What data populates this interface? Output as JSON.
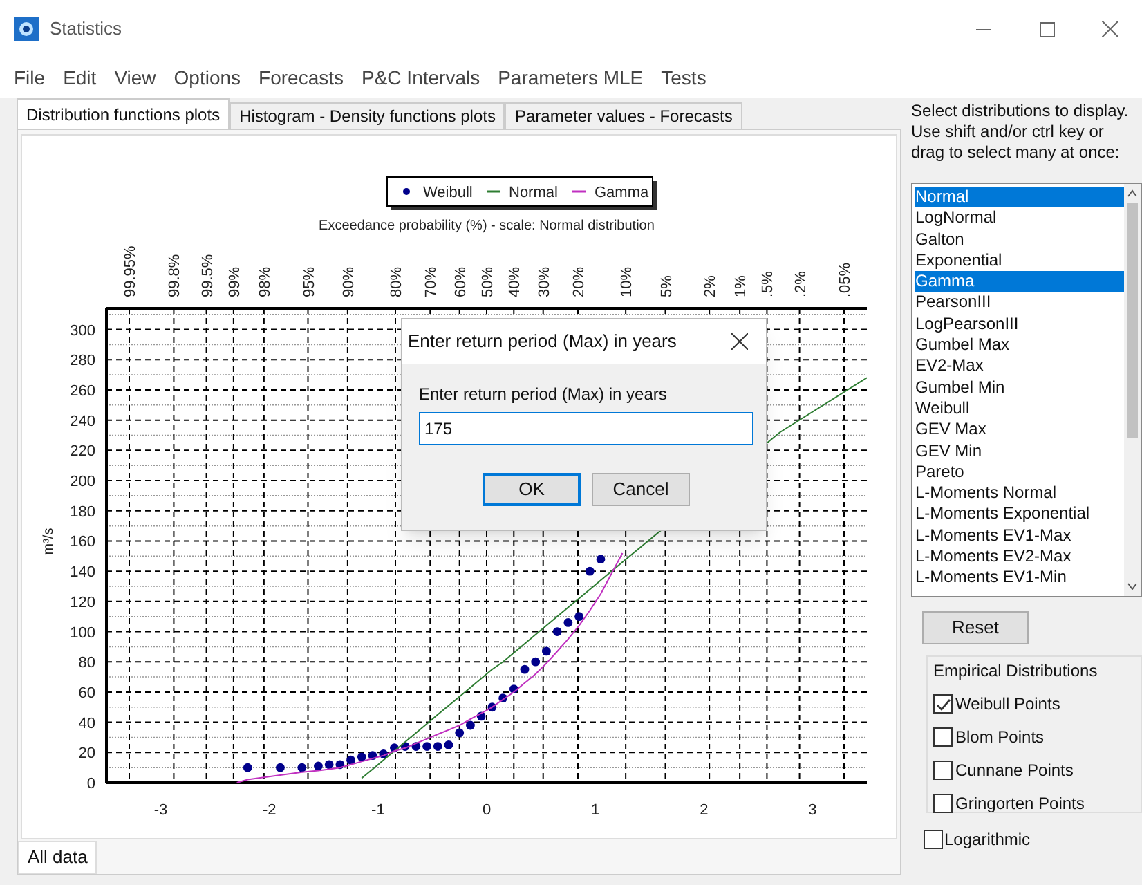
{
  "window": {
    "title": "Statistics"
  },
  "menu": [
    "File",
    "Edit",
    "View",
    "Options",
    "Forecasts",
    "P&C Intervals",
    "Parameters MLE",
    "Tests"
  ],
  "tabs": [
    {
      "label": "Distribution functions plots",
      "selected": true
    },
    {
      "label": "Histogram - Density functions plots",
      "selected": false
    },
    {
      "label": "Parameter values - Forecasts",
      "selected": false
    }
  ],
  "chart": {
    "top_axis": {
      "title": "Exceedance probability (%) - scale: Normal distribution",
      "ticks": [
        "99.95%",
        "99.8%",
        "99.5%",
        "99%",
        "98%",
        "95%",
        "90%",
        "80%",
        "70%",
        "60%",
        "50%",
        "40%",
        "30%",
        "20%",
        "10%",
        "5%",
        "2%",
        "1%",
        ".5%",
        ".2%",
        ".05%"
      ]
    },
    "chart_data": {
      "type": "line",
      "ylabel": "m³/s",
      "legend": "top",
      "grid": true,
      "x": [
        -2.3,
        -2.2,
        -1.9,
        -1.7,
        -1.55,
        -1.45,
        -1.35,
        -1.25,
        -1.15,
        -1.05,
        -0.95,
        -0.85,
        -0.75,
        -0.65,
        -0.55,
        -0.45,
        -0.35,
        -0.25,
        -0.15,
        -0.05,
        0.05,
        0.15,
        0.25,
        0.35,
        0.45,
        0.55,
        0.65,
        0.75,
        0.85,
        0.95,
        1.05,
        1.25,
        2.7,
        3.5
      ],
      "series": [
        {
          "name": "Weibull",
          "type": "scatter",
          "color": "#00008b",
          "values": [
            null,
            10,
            10,
            10,
            11,
            12,
            12,
            15,
            17,
            18,
            19,
            23,
            24,
            24,
            24,
            24,
            25,
            33,
            38,
            44,
            50,
            56,
            62,
            75,
            80,
            87,
            100,
            106,
            110,
            140,
            148,
            null,
            null,
            null
          ]
        },
        {
          "name": "Normal",
          "type": "line",
          "color": "#2e7d32",
          "values": [
            null,
            null,
            null,
            null,
            null,
            null,
            null,
            null,
            3,
            9,
            15,
            21,
            27,
            33,
            39,
            45,
            51,
            57,
            63,
            69,
            75,
            80,
            86,
            92,
            98,
            104,
            110,
            116,
            122,
            128,
            134,
            146,
            232,
            268
          ]
        },
        {
          "name": "Gamma",
          "type": "line",
          "color": "#c030c0",
          "values": [
            0,
            2,
            5,
            7,
            8,
            9,
            10,
            12,
            14,
            16,
            18,
            21,
            23,
            26,
            29,
            32,
            35,
            38,
            42,
            46,
            50,
            55,
            60,
            66,
            72,
            79,
            87,
            95,
            104,
            114,
            125,
            152,
            null,
            null
          ]
        }
      ],
      "xlim": [
        -3.5,
        3.5
      ],
      "ylim": [
        0,
        314
      ],
      "xticks": [
        -3,
        -2,
        -1,
        0,
        1,
        2,
        3
      ],
      "yticks": [
        0,
        20,
        40,
        60,
        80,
        100,
        120,
        140,
        160,
        180,
        200,
        220,
        240,
        260,
        280,
        300
      ]
    }
  },
  "bottom_tabs": [
    {
      "label": "All data",
      "selected": true
    }
  ],
  "dialog": {
    "title": "Enter return period (Max) in years",
    "prompt": "Enter return period (Max) in years",
    "value": "175",
    "buttons": [
      {
        "label": "OK",
        "kind": "primary"
      },
      {
        "label": "Cancel",
        "kind": "secondary"
      }
    ]
  },
  "sidebar": {
    "instructions": [
      "Select distributions to display.",
      "Use shift and/or ctrl key or",
      "drag to select many at once:"
    ],
    "distributions": [
      {
        "label": "Normal",
        "selected": true
      },
      {
        "label": "LogNormal",
        "selected": false
      },
      {
        "label": "Galton",
        "selected": false
      },
      {
        "label": "Exponential",
        "selected": false
      },
      {
        "label": "Gamma",
        "selected": true
      },
      {
        "label": "PearsonIII",
        "selected": false
      },
      {
        "label": "LogPearsonIII",
        "selected": false
      },
      {
        "label": "Gumbel Max",
        "selected": false
      },
      {
        "label": "EV2-Max",
        "selected": false
      },
      {
        "label": "Gumbel Min",
        "selected": false
      },
      {
        "label": "Weibull",
        "selected": false
      },
      {
        "label": "GEV Max",
        "selected": false
      },
      {
        "label": "GEV Min",
        "selected": false
      },
      {
        "label": "Pareto",
        "selected": false
      },
      {
        "label": "L-Moments Normal",
        "selected": false
      },
      {
        "label": "L-Moments Exponential",
        "selected": false
      },
      {
        "label": "L-Moments EV1-Max",
        "selected": false
      },
      {
        "label": "L-Moments EV2-Max",
        "selected": false
      },
      {
        "label": "L-Moments EV1-Min",
        "selected": false
      }
    ],
    "reset_button": "Reset",
    "group": {
      "title": "Empirical Distributions",
      "options": [
        {
          "label": "Weibull Points",
          "checked": true
        },
        {
          "label": "Blom Points",
          "checked": false
        },
        {
          "label": "Cunnane Points",
          "checked": false
        },
        {
          "label": "Gringorten Points",
          "checked": false
        }
      ]
    },
    "logarithmic": {
      "label": "Logarithmic",
      "checked": false
    }
  }
}
